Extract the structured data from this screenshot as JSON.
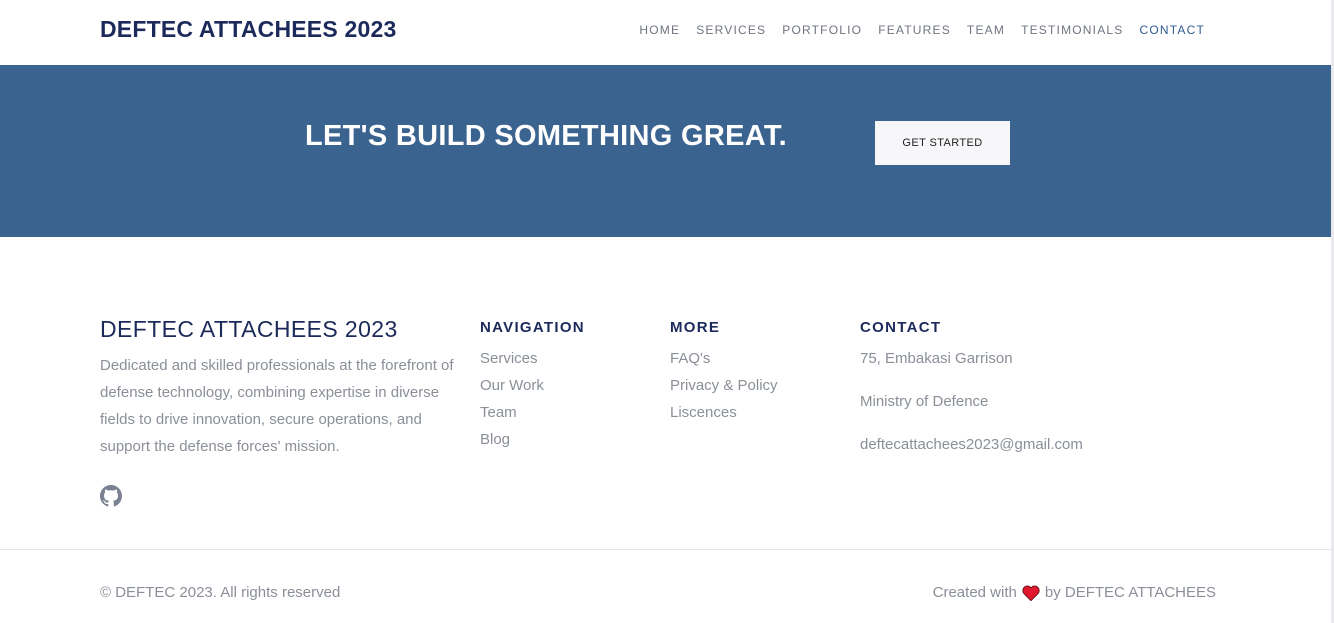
{
  "header": {
    "brand": "DEFTEC ATTACHEES 2023",
    "nav": [
      {
        "label": "HOME"
      },
      {
        "label": "SERVICES"
      },
      {
        "label": "PORTFOLIO"
      },
      {
        "label": "FEATURES"
      },
      {
        "label": "TEAM"
      },
      {
        "label": "TESTIMONIALS"
      },
      {
        "label": "CONTACT",
        "active": true
      }
    ]
  },
  "banner": {
    "title": "LET'S BUILD SOMETHING GREAT.",
    "cta_label": "GET STARTED"
  },
  "footer": {
    "about": {
      "title": "DEFTEC ATTACHEES 2023",
      "description": "Dedicated and skilled professionals at the forefront of defense technology, combining expertise in diverse fields to drive innovation, secure operations, and support the defense forces' mission.",
      "social_icon": "github-icon"
    },
    "navigation": {
      "heading": "NAVIGATION",
      "links": [
        "Services",
        "Our Work",
        "Team",
        "Blog"
      ]
    },
    "more": {
      "heading": "MORE",
      "links": [
        "FAQ's",
        "Privacy & Policy",
        "Liscences"
      ]
    },
    "contact": {
      "heading": "CONTACT",
      "address": "75, Embakasi Garrison",
      "organization": "Ministry of Defence",
      "email": "deftecattachees2023@gmail.com"
    },
    "copyright": "© DEFTEC 2023. All rights reserved",
    "credit_prefix": "Created with",
    "credit_suffix": "by DEFTEC ATTACHEES",
    "credit_icon": "heart-icon"
  },
  "colors": {
    "primary": "#1b2a5a",
    "banner": "#3b6390",
    "muted_text": "#8a8f98",
    "heart": "#e0182d"
  }
}
